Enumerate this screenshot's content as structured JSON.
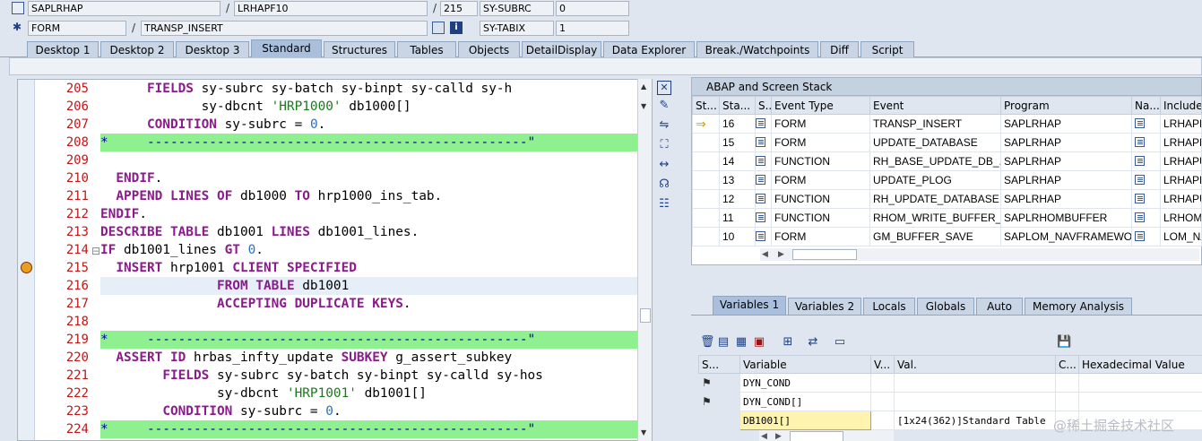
{
  "header": {
    "row1": {
      "program": "SAPLRHAP",
      "include": "LRHAPF10",
      "line": "215",
      "sysubrc_label": "SY-SUBRC",
      "sysubrc_value": "0"
    },
    "row2": {
      "event_type": "FORM",
      "event": "TRANSP_INSERT",
      "sytabix_label": "SY-TABIX",
      "sytabix_value": "1"
    },
    "separator": "/"
  },
  "tabs": [
    "Desktop 1",
    "Desktop 2",
    "Desktop 3",
    "Standard",
    "Structures",
    "Tables",
    "Objects",
    "DetailDisplay",
    "Data Explorer",
    "Break./Watchpoints",
    "Diff",
    "Script"
  ],
  "active_tab": "Standard",
  "editor": {
    "lines": [
      {
        "n": "205",
        "segs": [
          [
            "      ",
            "t"
          ],
          [
            "FIELDS",
            "kw"
          ],
          [
            " sy-subrc sy-batch sy-binpt sy-calld sy-h",
            "t"
          ]
        ]
      },
      {
        "n": "206",
        "segs": [
          [
            "             sy-dbcnt ",
            "t"
          ],
          [
            "'HRP1000'",
            "str"
          ],
          [
            " db1000[]",
            "t"
          ]
        ]
      },
      {
        "n": "207",
        "segs": [
          [
            "      ",
            "t"
          ],
          [
            "CONDITION",
            "kw"
          ],
          [
            " sy-subrc = ",
            "t"
          ],
          [
            "0",
            "num"
          ],
          [
            ".",
            "t"
          ]
        ]
      },
      {
        "n": "208",
        "segs": [
          [
            "*     -------------------------------------------------\"",
            "cmt"
          ]
        ],
        "bg": "green"
      },
      {
        "n": "209",
        "segs": [
          [
            "",
            "t"
          ]
        ]
      },
      {
        "n": "210",
        "segs": [
          [
            "  ",
            "t"
          ],
          [
            "ENDIF",
            "kw"
          ],
          [
            ".",
            "t"
          ]
        ]
      },
      {
        "n": "211",
        "segs": [
          [
            "  ",
            "t"
          ],
          [
            "APPEND LINES OF",
            "kw"
          ],
          [
            " db1000 ",
            "t"
          ],
          [
            "TO",
            "kw"
          ],
          [
            " hrp1000_ins_tab.",
            "t"
          ]
        ]
      },
      {
        "n": "212",
        "segs": [
          [
            "",
            "t"
          ],
          [
            "ENDIF",
            "kw"
          ],
          [
            ".",
            "t"
          ]
        ]
      },
      {
        "n": "213",
        "segs": [
          [
            "",
            "t"
          ],
          [
            "DESCRIBE TABLE",
            "kw"
          ],
          [
            " db1001 ",
            "t"
          ],
          [
            "LINES",
            "kw"
          ],
          [
            " db1001_lines.",
            "t"
          ]
        ]
      },
      {
        "n": "214",
        "segs": [
          [
            "",
            "t"
          ],
          [
            "IF",
            "kw"
          ],
          [
            " db1001_lines ",
            "t"
          ],
          [
            "GT",
            "kw"
          ],
          [
            " ",
            "t"
          ],
          [
            "0",
            "num"
          ],
          [
            ".",
            "t"
          ]
        ],
        "fold": "⊟"
      },
      {
        "n": "215",
        "segs": [
          [
            "  ",
            "t"
          ],
          [
            "INSERT",
            "kw"
          ],
          [
            " hrp1001 ",
            "t"
          ],
          [
            "CLIENT SPECIFIED",
            "kw"
          ]
        ],
        "bp": true
      },
      {
        "n": "216",
        "segs": [
          [
            "               ",
            "t"
          ],
          [
            "FROM TABLE",
            "kw"
          ],
          [
            " db1001",
            "t"
          ]
        ],
        "bg": "blue"
      },
      {
        "n": "217",
        "segs": [
          [
            "               ",
            "t"
          ],
          [
            "ACCEPTING DUPLICATE KEYS",
            "kw"
          ],
          [
            ".",
            "t"
          ]
        ]
      },
      {
        "n": "218",
        "segs": [
          [
            "",
            "t"
          ]
        ]
      },
      {
        "n": "219",
        "segs": [
          [
            "*     -------------------------------------------------\"",
            "cmt"
          ]
        ],
        "bg": "green"
      },
      {
        "n": "220",
        "segs": [
          [
            "  ",
            "t"
          ],
          [
            "ASSERT ID",
            "kw"
          ],
          [
            " hrbas_infty_update ",
            "t"
          ],
          [
            "SUBKEY",
            "kw"
          ],
          [
            " g_assert_subkey",
            "t"
          ]
        ]
      },
      {
        "n": "221",
        "segs": [
          [
            "        ",
            "t"
          ],
          [
            "FIELDS",
            "kw"
          ],
          [
            " sy-subrc sy-batch sy-binpt sy-calld sy-hos",
            "t"
          ]
        ]
      },
      {
        "n": "222",
        "segs": [
          [
            "               sy-dbcnt ",
            "t"
          ],
          [
            "'HRP1001'",
            "str"
          ],
          [
            " db1001[]",
            "t"
          ]
        ]
      },
      {
        "n": "223",
        "segs": [
          [
            "        ",
            "t"
          ],
          [
            "CONDITION",
            "kw"
          ],
          [
            " sy-subrc = ",
            "t"
          ],
          [
            "0",
            "num"
          ],
          [
            ".",
            "t"
          ]
        ]
      },
      {
        "n": "224",
        "segs": [
          [
            "*     -------------------------------------------------\"",
            "cmt"
          ]
        ],
        "bg": "green"
      }
    ]
  },
  "stack": {
    "title": "ABAP and Screen Stack",
    "columns": [
      "St...",
      "Sta...",
      "S...",
      "Event Type",
      "Event",
      "Program",
      "Na...",
      "Include"
    ],
    "rows": [
      {
        "current": true,
        "level": "16",
        "event_type": "FORM",
        "event": "TRANSP_INSERT",
        "program": "SAPLRHAP",
        "include": "LRHAPF"
      },
      {
        "current": false,
        "level": "15",
        "event_type": "FORM",
        "event": "UPDATE_DATABASE",
        "program": "SAPLRHAP",
        "include": "LRHAPF"
      },
      {
        "current": false,
        "level": "14",
        "event_type": "FUNCTION",
        "event": "RH_BASE_UPDATE_DB_...",
        "program": "SAPLRHAP",
        "include": "LRHAPU"
      },
      {
        "current": false,
        "level": "13",
        "event_type": "FORM",
        "event": "UPDATE_PLOG",
        "program": "SAPLRHAP",
        "include": "LRHAPF"
      },
      {
        "current": false,
        "level": "12",
        "event_type": "FUNCTION",
        "event": "RH_UPDATE_DATABASE",
        "program": "SAPLRHAP",
        "include": "LRHAPU"
      },
      {
        "current": false,
        "level": "11",
        "event_type": "FUNCTION",
        "event": "RHOM_WRITE_BUFFER_...",
        "program": "SAPLRHOMBUFFER",
        "include": "LRHOME"
      },
      {
        "current": false,
        "level": "10",
        "event_type": "FORM",
        "event": "GM_BUFFER_SAVE",
        "program": "SAPLOM_NAVFRAMEWO...",
        "include": "LOM_NA"
      }
    ]
  },
  "var_tabs": [
    "Variables 1",
    "Variables 2",
    "Locals",
    "Globals",
    "Auto",
    "Memory Analysis"
  ],
  "active_var_tab": "Variables 1",
  "variables": {
    "columns": [
      "S...",
      "Variable",
      "V...",
      "Val.",
      "C...",
      "Hexadecimal Value"
    ],
    "rows": [
      {
        "name": "DYN_COND",
        "value": ""
      },
      {
        "name": "DYN_COND[]",
        "value": ""
      },
      {
        "name": "DB1001[]",
        "value": "[1x24(362)]Standard Table"
      }
    ]
  },
  "watermark": "@稀土掘金技术社区"
}
